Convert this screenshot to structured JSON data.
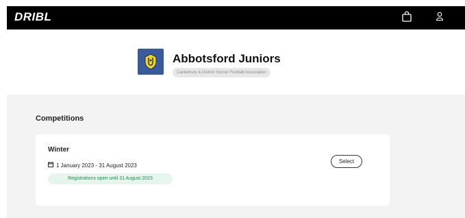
{
  "header": {
    "logo": "DRIBL",
    "icons": [
      "shopping-bag-icon",
      "user-icon"
    ]
  },
  "club": {
    "name": "Abbotsford Juniors",
    "association": "Canterbury & District Soccer Football Association",
    "logo_color": "#3a5b9b"
  },
  "competitions": {
    "title": "Competitions",
    "items": [
      {
        "name": "Winter",
        "dates": "1 January 2023 - 31 August 2023",
        "registration_status": "Registrations open until 31 August 2023",
        "action_label": "Select"
      }
    ]
  },
  "colors": {
    "topbar": "#000000",
    "background": "#f3f3f3",
    "status_text": "#1f8a4c",
    "status_bg": "#e6f6ec"
  }
}
